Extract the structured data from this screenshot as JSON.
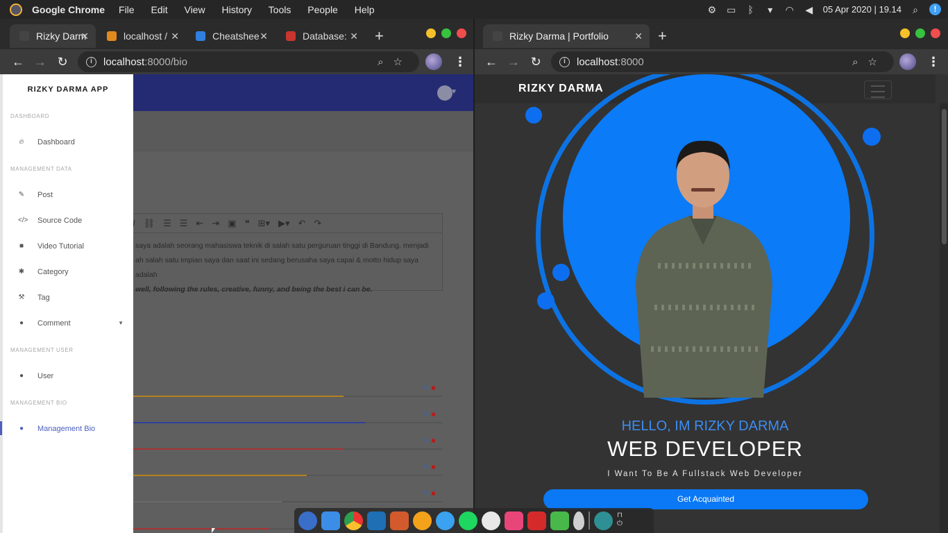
{
  "topbar": {
    "app_name": "Google Chrome",
    "menu": [
      "File",
      "Edit",
      "View",
      "History",
      "Tools",
      "People",
      "Help"
    ],
    "datetime": "05 Apr 2020 | 19.14"
  },
  "left_window": {
    "tabs": [
      {
        "label": "Rizky Darm",
        "active": true
      },
      {
        "label": "localhost /",
        "active": false
      },
      {
        "label": "Cheatshee",
        "active": false
      },
      {
        "label": "Database:",
        "active": false
      }
    ],
    "url_host": "localhost",
    "url_path": ":8000/bio",
    "sidebar": {
      "brand": "RIZKY DARMA APP",
      "sections": [
        {
          "title": "DASHBOARD",
          "items": [
            {
              "label": "Dashboard",
              "icon": "fire-icon"
            }
          ]
        },
        {
          "title": "MANAGEMENT DATA",
          "items": [
            {
              "label": "Post",
              "icon": "pen-icon"
            },
            {
              "label": "Source Code",
              "icon": "code-icon"
            },
            {
              "label": "Video Tutorial",
              "icon": "video-icon"
            },
            {
              "label": "Category",
              "icon": "asterisk-icon"
            },
            {
              "label": "Tag",
              "icon": "hammer-icon"
            },
            {
              "label": "Comment",
              "icon": "comments-icon"
            }
          ]
        },
        {
          "title": "MANAGEMENT USER",
          "items": [
            {
              "label": "User",
              "icon": "user-icon"
            }
          ]
        },
        {
          "title": "MANAGEMENT BIO",
          "items": [
            {
              "label": "Management Bio",
              "icon": "user-icon"
            }
          ]
        }
      ]
    },
    "editor": {
      "line1": "saya adalah seorang mahasiswa teknik di salah satu perguruan tinggi di Bandung. menjadi",
      "line2": "ah salah satu impian saya dan saat ini sedang berusaha saya capai & motto hidup saya adalah",
      "line3": "well, following the rules, creative, funny, and being the best i can be."
    },
    "skill_bars": [
      {
        "color": "#b5821f",
        "level": 0.68
      },
      {
        "color": "#2d3f9c",
        "level": 0.75
      },
      {
        "color": "#a83232",
        "level": 0.68
      },
      {
        "color": "#b5821f",
        "level": 0.56
      },
      {
        "color": "#6a6a6a",
        "level": 0.48
      },
      {
        "color": "#a83232",
        "level": 0.44
      }
    ]
  },
  "right_window": {
    "tab_label": "Rizky Darma | Portfolio",
    "url_host": "localhost",
    "url_path": ":8000",
    "brand": "RIZKY DARMA",
    "hello": "HELLO, IM RIZKY DARMA",
    "role": "WEB DEVELOPER",
    "tagline": "I Want To Be A Fullstack Web Developer",
    "cta": "Get Acquainted"
  },
  "colors": {
    "accent_blue": "#0b78f5",
    "admin_nav": "#242b73",
    "sidebar_active": "#4c5fbf"
  }
}
